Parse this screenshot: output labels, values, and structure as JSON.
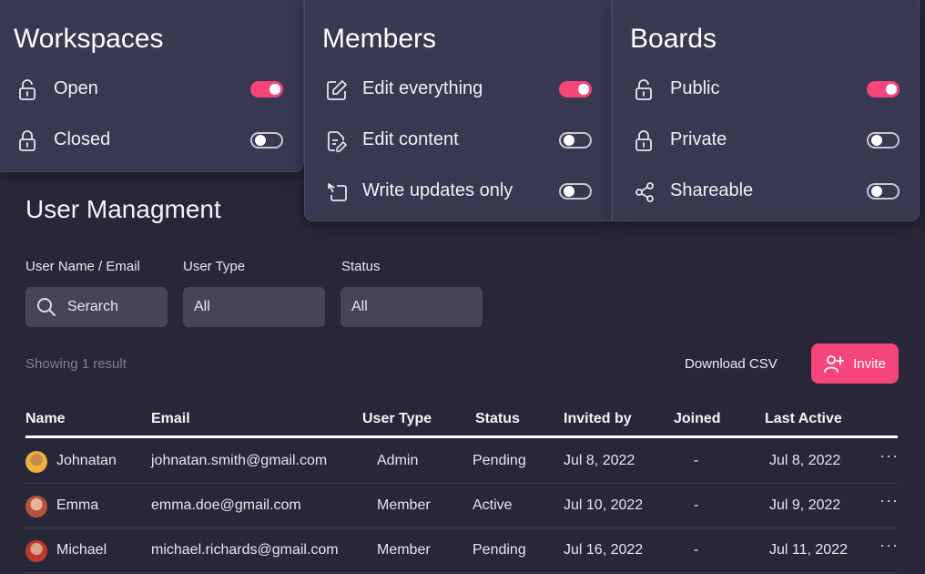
{
  "cards": [
    {
      "title": "Workspaces",
      "options": [
        {
          "label": "Open",
          "icon": "lock-open-icon",
          "on": true
        },
        {
          "label": "Closed",
          "icon": "lock-icon",
          "on": false
        }
      ]
    },
    {
      "title": "Members",
      "options": [
        {
          "label": "Edit everything",
          "icon": "edit-icon",
          "on": true
        },
        {
          "label": "Edit content",
          "icon": "document-edit-icon",
          "on": false
        },
        {
          "label": "Write updates only",
          "icon": "reply-arrow-icon",
          "on": false
        }
      ]
    },
    {
      "title": "Boards",
      "options": [
        {
          "label": "Public",
          "icon": "lock-open-icon",
          "on": true
        },
        {
          "label": "Private",
          "icon": "lock-icon",
          "on": false
        },
        {
          "label": "Shareable",
          "icon": "share-icon",
          "on": false
        }
      ]
    }
  ],
  "management": {
    "title": "User Managment",
    "filters": {
      "user_label": "User Name / Email",
      "search_placeholder": "Serarch",
      "type_label": "User Type",
      "type_value": "All",
      "status_label": "Status",
      "status_value": "All"
    },
    "showing": "Showing 1 result",
    "download": "Download CSV",
    "invite": "Invite"
  },
  "table": {
    "headers": [
      "Name",
      "Email",
      "User Type",
      "Status",
      "Invited by",
      "Joined",
      "Last Active"
    ],
    "rows": [
      {
        "name": "Johnatan",
        "email": "johnatan.smith@gmail.com",
        "type": "Admin",
        "status": "Pending",
        "invited": "Jul 8, 2022",
        "joined": "-",
        "last": "Jul 8, 2022",
        "more": "···"
      },
      {
        "name": "Emma",
        "email": "emma.doe@gmail.com",
        "type": "Member",
        "status": "Active",
        "invited": "Jul 10, 2022",
        "joined": "-",
        "last": "Jul 9, 2022",
        "more": "···"
      },
      {
        "name": "Michael",
        "email": "michael.richards@gmail.com",
        "type": "Member",
        "status": "Pending",
        "invited": "Jul 16, 2022",
        "joined": "-",
        "last": "Jul 11, 2022",
        "more": "···"
      }
    ]
  },
  "colors": {
    "accent": "#f5457a",
    "panel": "#282739",
    "card": "#393851"
  }
}
